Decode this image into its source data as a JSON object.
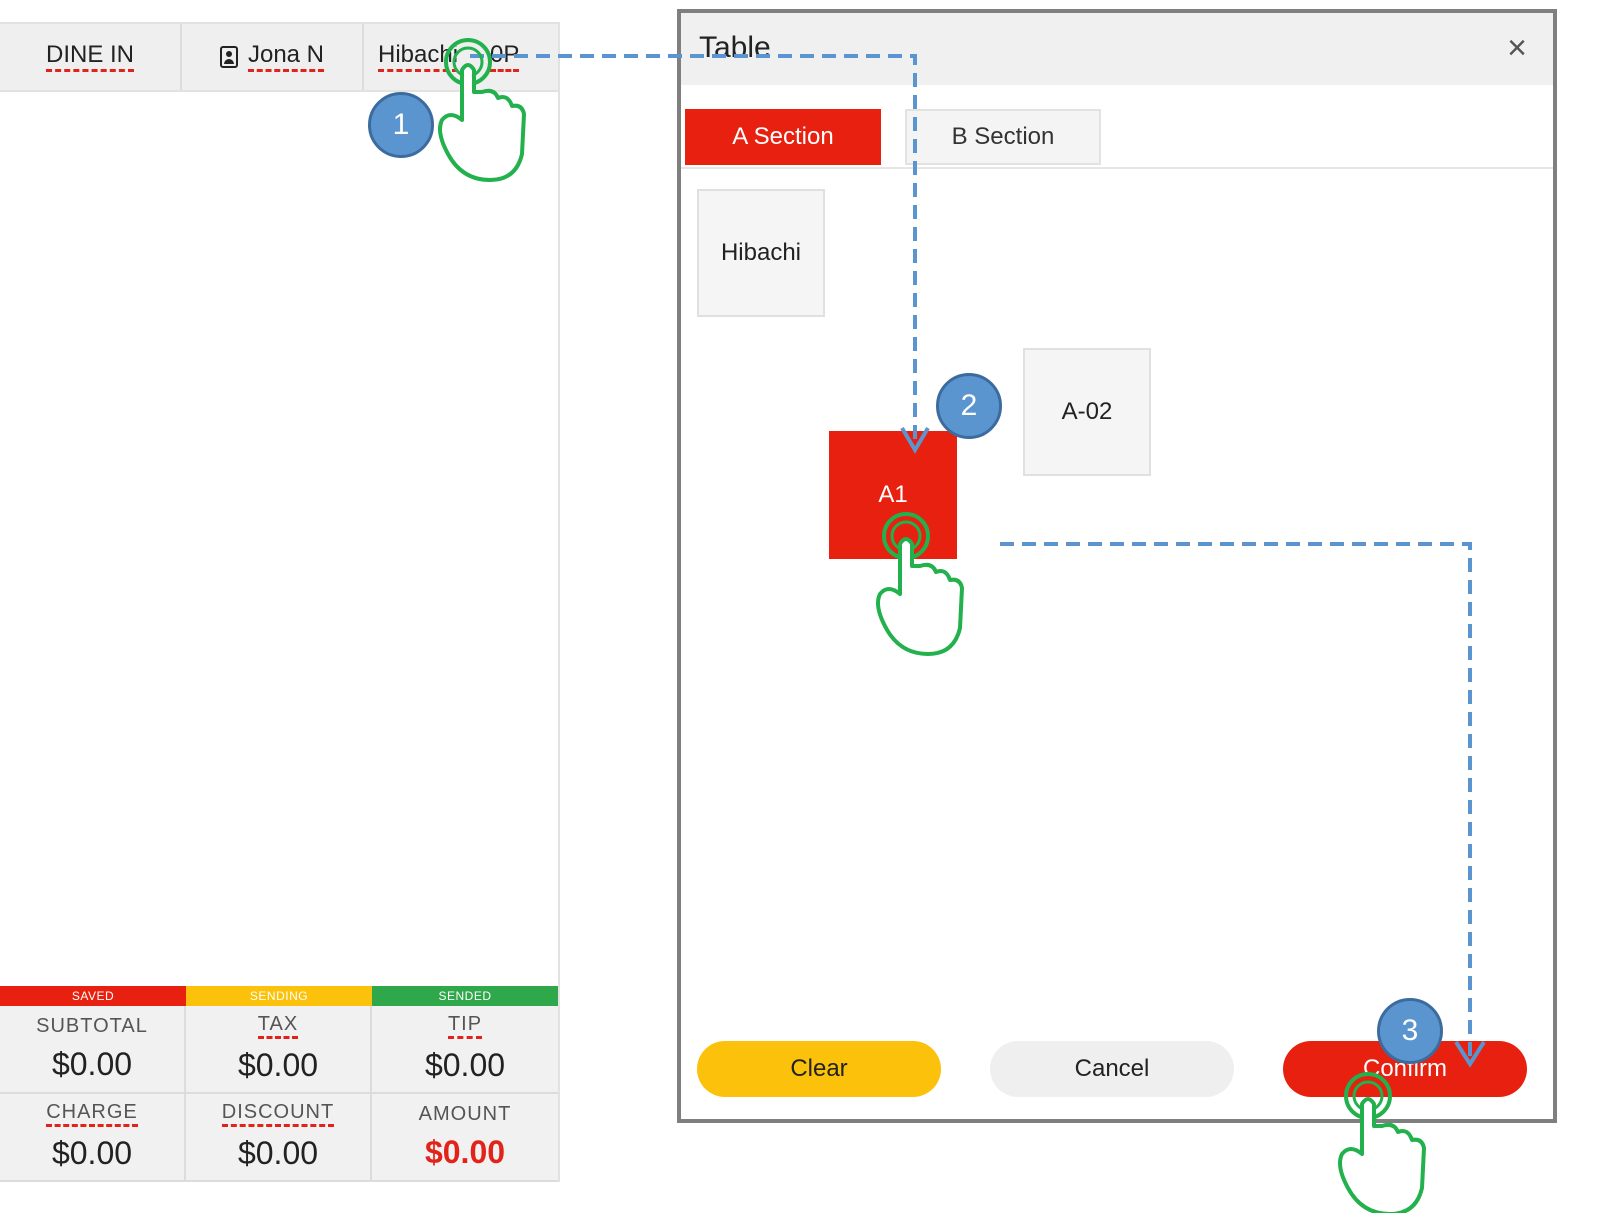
{
  "order_panel": {
    "tabs": {
      "dine_in": "DINE IN",
      "customer": "Jona N",
      "table": "Hibachi",
      "extra": "0P"
    },
    "status": [
      {
        "label": "SAVED",
        "color": "#e8200f"
      },
      {
        "label": "SENDING",
        "color": "#fcc10a"
      },
      {
        "label": "SENDED",
        "color": "#2ea84a"
      }
    ],
    "totals": {
      "subtotal_label": "SUBTOTAL",
      "subtotal_value": "$0.00",
      "tax_label": "TAX",
      "tax_value": "$0.00",
      "tip_label": "TIP",
      "tip_value": "$0.00",
      "charge_label": "CHARGE",
      "charge_value": "$0.00",
      "discount_label": "DISCOUNT",
      "discount_value": "$0.00",
      "amount_label": "AMOUNT",
      "amount_value": "$0.00"
    }
  },
  "dialog": {
    "title": "Table",
    "close_icon": "×",
    "sections": [
      {
        "label": "A Section",
        "active": true
      },
      {
        "label": "B Section",
        "active": false
      }
    ],
    "tables": {
      "hibachi": "Hibachi",
      "a1": "A1",
      "a02": "A-02"
    },
    "buttons": {
      "clear": "Clear",
      "cancel": "Cancel",
      "confirm": "Confirm"
    }
  },
  "annotations": {
    "steps": [
      "1",
      "2",
      "3"
    ]
  },
  "colors": {
    "accent_red": "#e8200f",
    "accent_yellow": "#fcc10a",
    "accent_green": "#2ea84a",
    "guide_blue": "#5b95d0",
    "hand_green": "#22b14c"
  }
}
